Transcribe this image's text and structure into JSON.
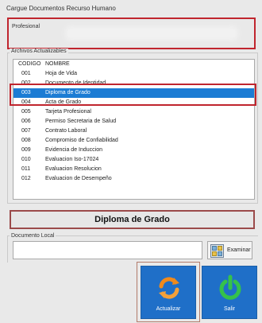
{
  "window": {
    "title": "Cargue Documentos Recurso Humano"
  },
  "profesional": {
    "label": "Profesional",
    "value": ""
  },
  "archivos": {
    "label": "Archivos Actualizables",
    "columns": [
      "CODIGO",
      "NOMBRE"
    ],
    "rows": [
      {
        "code": "001",
        "name": "Hoja de Vida"
      },
      {
        "code": "002",
        "name": "Documento de Identidad"
      },
      {
        "code": "003",
        "name": "Diploma de Grado",
        "selected": true
      },
      {
        "code": "004",
        "name": "Acta de Grado"
      },
      {
        "code": "005",
        "name": "Tarjeta Profesional"
      },
      {
        "code": "006",
        "name": "Permiso Secretaria de Salud"
      },
      {
        "code": "007",
        "name": "Contrato Laboral"
      },
      {
        "code": "008",
        "name": "Compromiso de Confiabilidad"
      },
      {
        "code": "009",
        "name": "Evidencia de Induccion"
      },
      {
        "code": "010",
        "name": "Evaluacion Iso-17024"
      },
      {
        "code": "011",
        "name": "Evaluacion Resolucion"
      },
      {
        "code": "012",
        "name": "Evaluacion de Desempeño"
      }
    ]
  },
  "selected_document": "Diploma de Grado",
  "documento_local": {
    "label": "Documento Local",
    "value": ""
  },
  "buttons": {
    "examinar": "Examinar",
    "actualizar": "Actualizar",
    "salir": "Salir"
  },
  "colors": {
    "selection": "#1c7cd4",
    "tile": "#1f6fc8",
    "highlight": "#c0252e",
    "refresh_orange": "#f08a1c",
    "power_green": "#35c24a"
  },
  "icons": {
    "examinar": "folder-grid-icon",
    "actualizar": "refresh-icon",
    "salir": "power-icon"
  }
}
